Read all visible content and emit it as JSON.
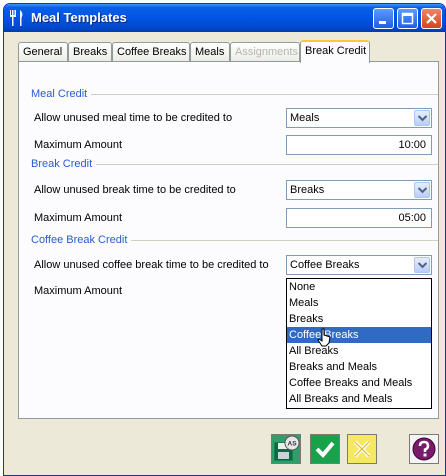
{
  "window": {
    "title": "Meal Templates"
  },
  "tabs": [
    {
      "label": "General",
      "state": "normal"
    },
    {
      "label": "Breaks",
      "state": "normal"
    },
    {
      "label": "Coffee Breaks",
      "state": "normal"
    },
    {
      "label": "Meals",
      "state": "normal"
    },
    {
      "label": "Assignments",
      "state": "disabled"
    },
    {
      "label": "Break Credit",
      "state": "active"
    }
  ],
  "sections": {
    "meal": {
      "title": "Meal Credit",
      "credit_label": "Allow unused meal time to be credited to",
      "credit_value": "Meals",
      "max_label": "Maximum Amount",
      "max_value": "10:00"
    },
    "break": {
      "title": "Break Credit",
      "credit_label": "Allow unused break time to be credited to",
      "credit_value": "Breaks",
      "max_label": "Maximum Amount",
      "max_value": "05:00"
    },
    "coffee": {
      "title": "Coffee Break Credit",
      "credit_label": "Allow unused coffee break time to be credited to",
      "credit_value": "Coffee Breaks",
      "max_label": "Maximum Amount"
    }
  },
  "dropdown": {
    "options": [
      "None",
      "Meals",
      "Breaks",
      "Coffee Breaks",
      "All Breaks",
      "Breaks and Meals",
      "Coffee Breaks and Meals",
      "All Breaks and Meals"
    ],
    "highlighted": "Coffee Breaks"
  },
  "buttons": {
    "save_badge": "AS"
  },
  "colors": {
    "title_bar": "#0054e3",
    "section_title": "#2a5bd1",
    "selection": "#316ac5",
    "active_tab_accent": "#ffc83c"
  },
  "icons": [
    "meal-templates-icon",
    "minimize-icon",
    "maximize-icon",
    "close-icon",
    "dropdown-arrow-icon",
    "save-as-icon",
    "ok-check-icon",
    "cancel-x-icon",
    "help-icon",
    "mouse-cursor-icon"
  ]
}
